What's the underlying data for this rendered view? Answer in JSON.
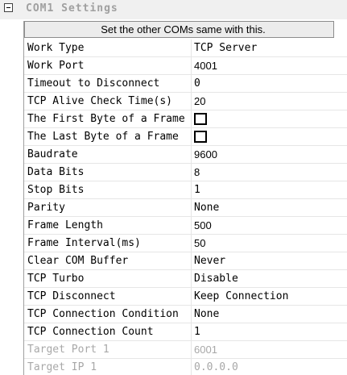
{
  "group": {
    "title": "COM1 Settings"
  },
  "sync_button": {
    "label": "Set the other COMs same with this."
  },
  "rows": [
    {
      "name": "Work Type",
      "value": "TCP Server",
      "font": "mono"
    },
    {
      "name": "Work Port",
      "value": "4001",
      "font": "sans"
    },
    {
      "name": "Timeout to Disconnect",
      "value": "0",
      "font": "mono"
    },
    {
      "name": "TCP Alive Check Time(s)",
      "value": "20",
      "font": "sans"
    },
    {
      "name": "The First Byte of a Frame",
      "value": "",
      "checkbox": true,
      "checked": false
    },
    {
      "name": "The Last Byte of a Frame",
      "value": "",
      "checkbox": true,
      "checked": false
    },
    {
      "name": "Baudrate",
      "value": "9600",
      "font": "sans"
    },
    {
      "name": "Data Bits",
      "value": "8",
      "font": "sans"
    },
    {
      "name": "Stop Bits",
      "value": "1",
      "font": "mono"
    },
    {
      "name": "Parity",
      "value": "None",
      "font": "mono"
    },
    {
      "name": "Frame Length",
      "value": "500",
      "font": "sans"
    },
    {
      "name": "Frame Interval(ms)",
      "value": "50",
      "font": "sans"
    },
    {
      "name": "Clear COM Buffer",
      "value": "Never",
      "font": "mono"
    },
    {
      "name": "TCP Turbo",
      "value": "Disable",
      "font": "mono"
    },
    {
      "name": "TCP Disconnect",
      "value": "Keep Connection",
      "font": "mono"
    },
    {
      "name": "TCP Connection Condition",
      "value": "None",
      "font": "mono"
    },
    {
      "name": "TCP Connection Count",
      "value": "1",
      "font": "mono"
    },
    {
      "name": "Target Port 1",
      "value": "6001",
      "font": "sans",
      "disabled": true
    },
    {
      "name": "Target IP 1",
      "value": "0.0.0.0",
      "font": "mono",
      "disabled": true
    }
  ]
}
